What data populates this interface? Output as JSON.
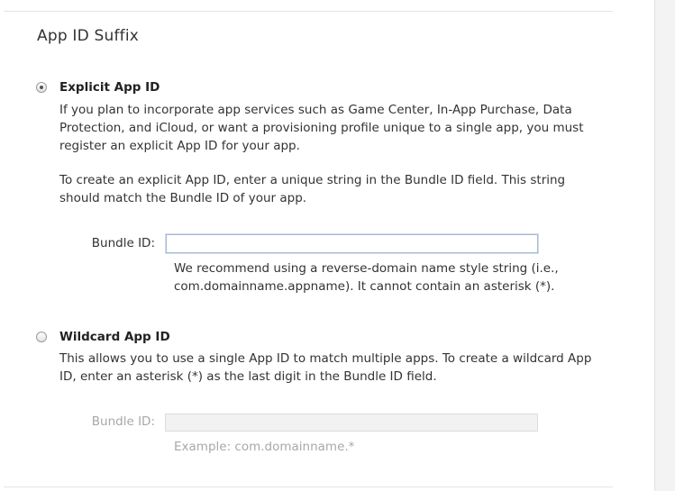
{
  "section": {
    "title": "App ID Suffix"
  },
  "explicit": {
    "title": "Explicit App ID",
    "selected": true,
    "description_lines": [
      "If you plan to incorporate app services such as Game Center, In-App Purchase, Data",
      "Protection, and iCloud, or want a provisioning profile unique to a single app, you must",
      "register an explicit App ID for your app."
    ],
    "instruction_lines": [
      "To create an explicit App ID, enter a unique string in the Bundle ID field. This string",
      "should match the Bundle ID of your app."
    ],
    "bundle_label": "Bundle ID:",
    "bundle_value": "",
    "hint_lines": [
      "We recommend using a reverse-domain name style string (i.e.,",
      "com.domainname.appname). It cannot contain an asterisk (*)."
    ]
  },
  "wildcard": {
    "title": "Wildcard App ID",
    "selected": false,
    "description_lines": [
      "This allows you to use a single App ID to match multiple apps. To create a wildcard App",
      "ID, enter an asterisk (*) as the last digit in the Bundle ID field."
    ],
    "bundle_label": "Bundle ID:",
    "bundle_value": "",
    "example": "Example: com.domainname.*"
  }
}
